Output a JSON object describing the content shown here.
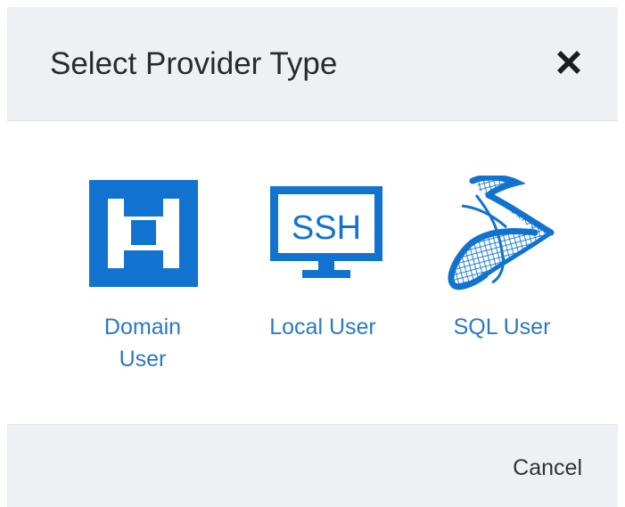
{
  "dialog": {
    "title": "Select Provider Type",
    "close_icon": "close-icon",
    "providers": [
      {
        "label": "Domain User",
        "icon": "domain-user-icon"
      },
      {
        "label": "Local User",
        "icon": "ssh-monitor-icon",
        "icon_text": "SSH"
      },
      {
        "label": "SQL User",
        "icon": "sql-server-icon"
      }
    ],
    "cancel_label": "Cancel"
  },
  "colors": {
    "accent_blue": "#1173cf",
    "link_blue": "#2a79c4",
    "header_bg": "#eef0f3",
    "title_text": "#2b2b2b"
  }
}
